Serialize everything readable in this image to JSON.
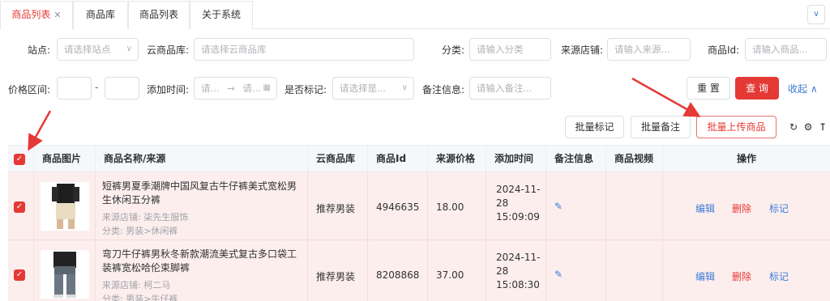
{
  "tabs": [
    {
      "label": "商品列表",
      "active": true,
      "closable": true
    },
    {
      "label": "商品库",
      "active": false
    },
    {
      "label": "商品列表",
      "active": false
    },
    {
      "label": "关于系统",
      "active": false
    }
  ],
  "tab_close_glyph": "✕",
  "tab_more_glyph": "∨",
  "filters": {
    "site_label": "站点:",
    "site_placeholder": "请选择站点",
    "cloud_label": "云商品库:",
    "cloud_placeholder": "请选择云商品库",
    "category_label": "分类:",
    "category_placeholder": "请输入分类",
    "store_label": "来源店铺:",
    "store_placeholder": "请输入来源...",
    "goods_id_label": "商品Id:",
    "goods_id_placeholder": "请输入商品...",
    "price_label": "价格区间:",
    "price_dash": "-",
    "add_time_label": "添加时间:",
    "date_start": "请...",
    "date_arrow": "→",
    "date_end": "请...",
    "marked_label": "是否标记:",
    "marked_placeholder": "请选择是...",
    "remark_label": "备注信息:",
    "remark_placeholder": "请输入备注..."
  },
  "buttons": {
    "reset": "重 置",
    "query": "查 询",
    "collapse": "收起 ∧",
    "batch_mark": "批量标记",
    "batch_remark": "批量备注",
    "batch_upload": "批量上传商品"
  },
  "toolbar_icons": [
    "refresh-icon",
    "settings-icon",
    "column-height-icon"
  ],
  "table": {
    "headers": [
      "商品图片",
      "商品名称/来源",
      "云商品库",
      "商品Id",
      "来源价格",
      "添加时间",
      "备注信息",
      "商品视频",
      "操作"
    ],
    "rows": [
      {
        "title": "短裤男夏季潮牌中国风复古牛仔裤美式宽松男生休闲五分裤",
        "store": "来源店铺: 柒先生服饰",
        "category": "分类: 男装>休闲裤",
        "cloud": "推荐男装",
        "goods_id": "4946635",
        "price": "18.00",
        "time_date": "2024-11-",
        "time_day": "28",
        "time_clock": "15:09:09",
        "actions": [
          "编辑",
          "删除",
          "标记"
        ]
      },
      {
        "title": "弯刀牛仔裤男秋冬新款潮流美式复古多口袋工装裤宽松哈伦束脚裤",
        "store": "来源店铺: 柯二马",
        "category": "分类: 男装>牛仔裤",
        "cloud": "推荐男装",
        "goods_id": "8208868",
        "price": "37.00",
        "time_date": "2024-11-",
        "time_day": "28",
        "time_clock": "15:08:30",
        "actions": [
          "编辑",
          "删除",
          "标记"
        ]
      }
    ]
  },
  "colors": {
    "accent": "#e53935",
    "link": "#3b7bd6",
    "row_selected": "#fdeeee"
  }
}
